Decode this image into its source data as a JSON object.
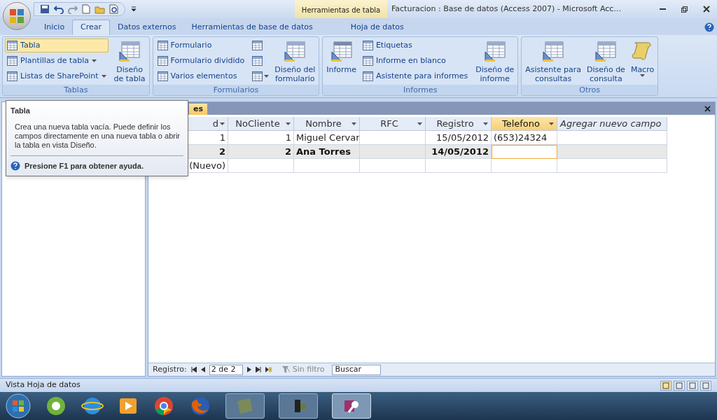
{
  "title_bar": {
    "context_tab": "Herramientas de tabla",
    "title": "Facturacion : Base de datos (Access 2007) - Microsoft Acc…"
  },
  "ribbon_tabs": [
    {
      "label": "Inicio",
      "selected": false,
      "kind": "normal"
    },
    {
      "label": "Crear",
      "selected": true,
      "kind": "normal"
    },
    {
      "label": "Datos externos",
      "selected": false,
      "kind": "normal"
    },
    {
      "label": "Herramientas de base de datos",
      "selected": false,
      "kind": "normal"
    },
    {
      "label": "Hoja de datos",
      "selected": false,
      "kind": "context"
    }
  ],
  "ribbon_groups": [
    {
      "label": "Tablas",
      "columns": [
        {
          "kind": "small",
          "items": [
            {
              "label": "Tabla",
              "dropdown": false,
              "hover": true
            },
            {
              "label": "Plantillas de tabla",
              "dropdown": true,
              "hover": false
            },
            {
              "label": "Listas de SharePoint",
              "dropdown": true,
              "hover": false
            }
          ]
        },
        {
          "kind": "large",
          "items": [
            {
              "label": "Diseño\nde tabla",
              "dropdown": false,
              "hover": false
            }
          ]
        }
      ]
    },
    {
      "label": "Formularios",
      "columns": [
        {
          "kind": "small",
          "items": [
            {
              "label": "Formulario",
              "dropdown": false,
              "hover": false
            },
            {
              "label": "Formulario dividido",
              "dropdown": false,
              "hover": false
            },
            {
              "label": "Varios elementos",
              "dropdown": false,
              "hover": false
            }
          ]
        },
        {
          "kind": "icons",
          "items": [
            {
              "dropdown": false,
              "hover": false
            },
            {
              "dropdown": false,
              "hover": false
            },
            {
              "dropdown": true,
              "hover": false
            }
          ]
        },
        {
          "kind": "large",
          "items": [
            {
              "label": "Diseño del\nformulario",
              "dropdown": false,
              "hover": false
            }
          ]
        }
      ]
    },
    {
      "label": "Informes",
      "columns": [
        {
          "kind": "large",
          "items": [
            {
              "label": "Informe",
              "dropdown": false,
              "hover": false
            }
          ]
        },
        {
          "kind": "small",
          "items": [
            {
              "label": "Etiquetas",
              "dropdown": false,
              "hover": false
            },
            {
              "label": "Informe en blanco",
              "dropdown": false,
              "hover": false
            },
            {
              "label": "Asistente para informes",
              "dropdown": false,
              "hover": false
            }
          ]
        },
        {
          "kind": "large",
          "items": [
            {
              "label": "Diseño de\ninforme",
              "dropdown": false,
              "hover": false
            }
          ]
        }
      ]
    },
    {
      "label": "Otros",
      "columns": [
        {
          "kind": "large",
          "items": [
            {
              "label": "Asistente para\nconsultas",
              "dropdown": false,
              "hover": false
            }
          ]
        },
        {
          "kind": "large",
          "items": [
            {
              "label": "Diseño de\nconsulta",
              "dropdown": false,
              "hover": false
            }
          ]
        },
        {
          "kind": "large",
          "items": [
            {
              "label": "Macro",
              "dropdown": true,
              "hover": false
            }
          ]
        }
      ]
    }
  ],
  "tooltip": {
    "title": "Tabla",
    "body": "Crea una nueva tabla vacía. Puede definir los campos directamente en una nueva tabla o abrir la tabla en vista Diseño.",
    "help": "Presione F1 para obtener ayuda."
  },
  "document": {
    "tab": "es",
    "columns": [
      {
        "label": "d",
        "kind": "field",
        "selected": false
      },
      {
        "label": "NoCliente",
        "kind": "field",
        "selected": false
      },
      {
        "label": "Nombre",
        "kind": "field",
        "selected": false
      },
      {
        "label": "RFC",
        "kind": "field",
        "selected": false
      },
      {
        "label": "Registro",
        "kind": "field",
        "selected": false
      },
      {
        "label": "Telefono",
        "kind": "field",
        "selected": true
      },
      {
        "label": "Agregar nuevo campo",
        "kind": "add",
        "selected": false
      }
    ],
    "rows": [
      {
        "selected": false,
        "cells": [
          "1",
          "1",
          "Miguel Cervar",
          null,
          "15/05/2012",
          "(653)24324",
          null
        ]
      },
      {
        "selected": true,
        "cells": [
          "2",
          "2",
          "Ana Torres",
          null,
          "14/05/2012",
          null,
          null
        ]
      },
      {
        "selected": false,
        "cells": [
          "(Nuevo)",
          null,
          null,
          null,
          null,
          null,
          null
        ]
      }
    ]
  },
  "record_nav": {
    "label": "Registro:",
    "position": "2 de 2",
    "filter": "Sin filtro",
    "search": {
      "placeholder": "Buscar"
    }
  },
  "status_bar": {
    "text": "Vista Hoja de datos"
  }
}
